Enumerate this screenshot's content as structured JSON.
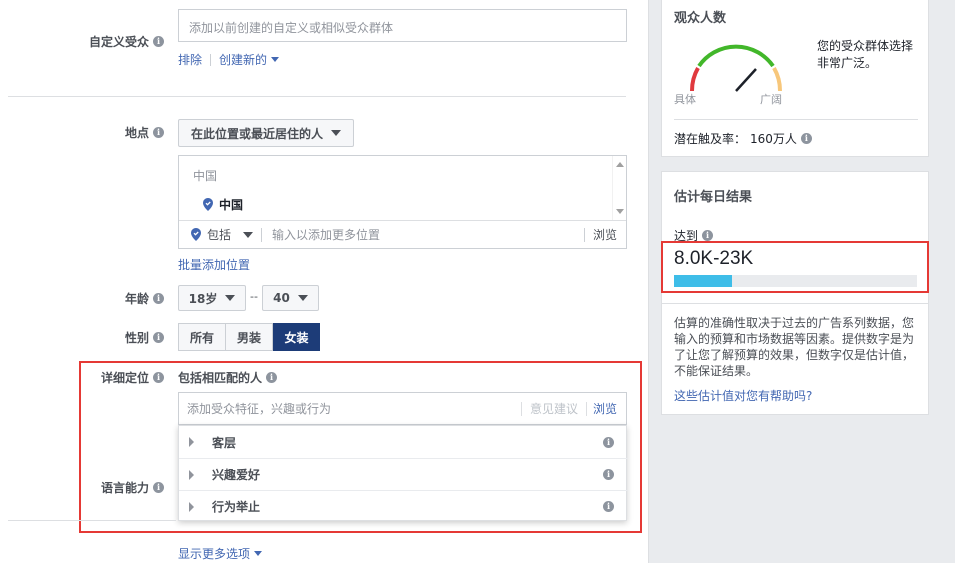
{
  "custom_audience": {
    "label": "自定义受众",
    "placeholder": "添加以前创建的自定义或相似受众群体",
    "exclude": "排除",
    "create_new": "创建新的"
  },
  "location": {
    "label": "地点",
    "dropdown": "在此位置或最近居住的人",
    "list_header": "中国",
    "selected": "中国",
    "include": "包括",
    "input_placeholder": "输入以添加更多位置",
    "browse": "浏览",
    "bulk_add": "批量添加位置"
  },
  "age": {
    "label": "年龄",
    "min": "18岁",
    "separator": "--",
    "max": "40"
  },
  "gender": {
    "label": "性别",
    "options": [
      "所有",
      "男装",
      "女装"
    ],
    "selected": "女装"
  },
  "detailed_targeting": {
    "label": "详细定位",
    "sub_label": "包括相匹配的人",
    "placeholder": "添加受众特征，兴趣或行为",
    "suggestions": "意见建议",
    "browse": "浏览",
    "categories": [
      "客层",
      "兴趣爱好",
      "行为举止"
    ]
  },
  "language": {
    "label": "语言能力"
  },
  "show_more": "显示更多选项",
  "audience_size": {
    "title": "观众人数",
    "gauge_left": "具体",
    "gauge_right": "广阔",
    "description": "您的受众群体选择非常广泛。",
    "reach_label": "潜在触及率：",
    "reach_value": "160万人"
  },
  "daily_results": {
    "title": "估计每日结果",
    "reach_label": "达到",
    "reach_range": "8.0K-23K",
    "bar_fill_fraction": 0.24,
    "note": "估算的准确性取决于过去的广告系列数据，您输入的预算和市场数据等因素。提供数字是为了让您了解预算的效果，但数字仅是估计值，不能保证结果。",
    "feedback_link": "这些估计值对您有帮助吗?"
  },
  "colors": {
    "accent": "#4267b2",
    "selected_gender": "#1d3c78",
    "bar_fill": "#3ebde8",
    "highlight": "#e53935",
    "gauge_green": "#42b72a",
    "gauge_red": "#e0393e",
    "gauge_yellow": "#f7c77b"
  }
}
